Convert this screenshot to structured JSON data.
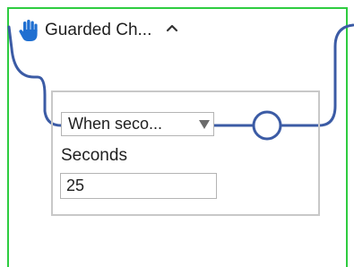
{
  "node": {
    "title": "Guarded Ch...",
    "icon": "hand-icon",
    "collapse_icon": "chevron-up-icon",
    "border_color": "#2ecc40",
    "connector_color": "#3b5ba5"
  },
  "trigger": {
    "selected_option": "When seco...",
    "field_label": "Seconds",
    "field_value": "25"
  }
}
